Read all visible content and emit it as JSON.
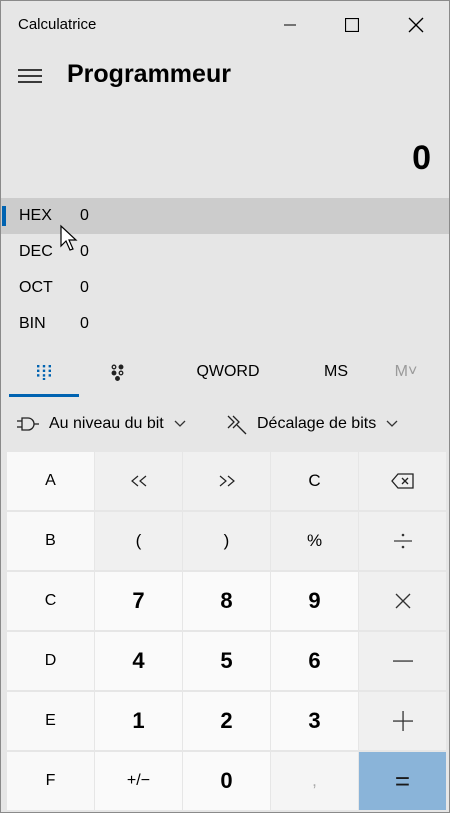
{
  "window": {
    "title": "Calculatrice"
  },
  "header": {
    "mode_title": "Programmeur"
  },
  "display": {
    "value": "0"
  },
  "radix": [
    {
      "label": "HEX",
      "value": "0",
      "selected": true
    },
    {
      "label": "DEC",
      "value": "0",
      "selected": false
    },
    {
      "label": "OCT",
      "value": "0",
      "selected": false
    },
    {
      "label": "BIN",
      "value": "0",
      "selected": false
    }
  ],
  "tabs": {
    "keypad_icon": "keypad-grid-icon",
    "bitflip_icon": "bit-toggle-icon",
    "word_size": "QWORD",
    "ms": "MS",
    "mv": "M˅"
  },
  "operators": {
    "bitwise_label": "Au niveau du bit",
    "shift_label": "Décalage de bits"
  },
  "keys": [
    [
      "A",
      "<<",
      ">>",
      "C",
      "⌫"
    ],
    [
      "B",
      "(",
      ")",
      "%",
      "÷"
    ],
    [
      "C",
      "7",
      "8",
      "9",
      "×"
    ],
    [
      "D",
      "4",
      "5",
      "6",
      "−"
    ],
    [
      "E",
      "1",
      "2",
      "3",
      "+"
    ],
    [
      "F",
      "+/−",
      "0",
      ",",
      "="
    ]
  ],
  "colors": {
    "accent": "#0063b1",
    "equals_bg": "#8ab4d9",
    "selected_row": "#cccccc",
    "window_bg": "#e6e6e6"
  }
}
